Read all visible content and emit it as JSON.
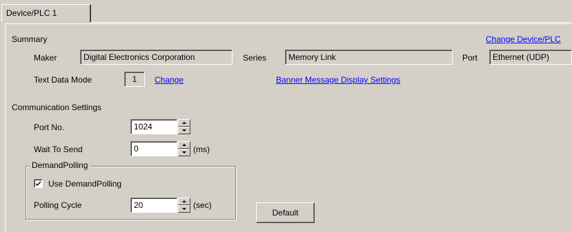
{
  "tab": {
    "label": "Device/PLC 1"
  },
  "summary": {
    "heading": "Summary",
    "change_device_link": "Change Device/PLC",
    "maker_label": "Maker",
    "maker_value": "Digital Electronics Corporation",
    "series_label": "Series",
    "series_value": "Memory Link",
    "port_label": "Port",
    "port_value": "Ethernet (UDP)",
    "text_mode_label": "Text Data Mode",
    "text_mode_value": "1",
    "change_link": "Change",
    "banner_link": "Banner Message Display Settings"
  },
  "comm": {
    "heading": "Communication Settings",
    "port_no_label": "Port No.",
    "port_no_value": "1024",
    "wait_label": "Wait To Send",
    "wait_value": "0",
    "wait_unit": "(ms)",
    "demand_group": "DemandPolling",
    "use_demand_label": "Use DemandPolling",
    "use_demand_checked": true,
    "polling_label": "Polling Cycle",
    "polling_value": "20",
    "polling_unit": "(sec)",
    "default_button": "Default"
  }
}
